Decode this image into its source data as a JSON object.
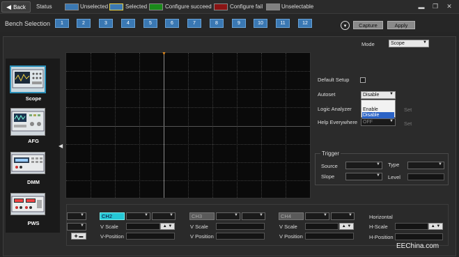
{
  "topbar": {
    "back_label": "Back",
    "status_label": "Status",
    "legend": [
      {
        "label": "Unselected",
        "color": "#3a78b3"
      },
      {
        "label": "Selected",
        "color": "#3a78b3"
      },
      {
        "label": "Configure succeed",
        "color": "#1a8a1a"
      },
      {
        "label": "Configure fail",
        "color": "#8a1414"
      },
      {
        "label": "Unselectable",
        "color": "#808080"
      }
    ],
    "window_controls": [
      "minimize-icon",
      "restore-icon",
      "close-icon"
    ]
  },
  "bench": {
    "label": "Bench Selection",
    "buttons": [
      "1",
      "2",
      "3",
      "4",
      "5",
      "6",
      "7",
      "8",
      "9",
      "10",
      "11",
      "12"
    ],
    "capture_label": "Capture",
    "apply_label": "Apply"
  },
  "sidebar": {
    "instruments": [
      {
        "label": "Scope",
        "selected": true
      },
      {
        "label": "AFG",
        "selected": false
      },
      {
        "label": "DMM",
        "selected": false
      },
      {
        "label": "PWS",
        "selected": false
      }
    ]
  },
  "settings": {
    "mode_label": "Mode",
    "mode_value": "Scope",
    "default_setup_label": "Default Setup",
    "autoset_label": "Autoset",
    "autoset_value": "Disable",
    "autoset_options": [
      "Enable",
      "Disable"
    ],
    "logic_analyzer_label": "Logic Analyzer",
    "logic_set": "Set",
    "help_everywhere_label": "Help Everywhere",
    "help_value": "OFF",
    "help_set": "Set"
  },
  "trigger": {
    "title": "Trigger",
    "source_label": "Source",
    "type_label": "Type",
    "slope_label": "Slope",
    "level_label": "Level"
  },
  "channels": {
    "ch2_tag": "CH2",
    "ch3_tag": "CH3",
    "ch4_tag": "CH4",
    "v_scale": "V Scale",
    "v_position": "V-Position",
    "v_position_alt": "V Position",
    "horizontal_label": "Horizontal",
    "h_scale": "H-Scale",
    "h_position": "H-Position"
  },
  "watermark": "EEChina.com"
}
